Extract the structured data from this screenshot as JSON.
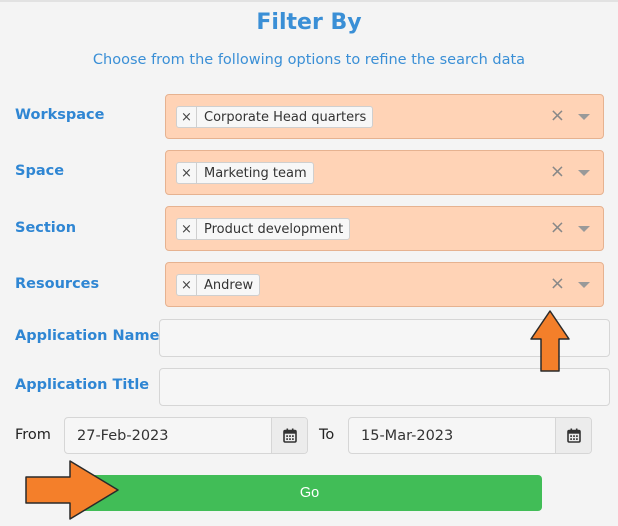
{
  "header": {
    "title": "Filter By",
    "subtitle": "Choose from the following options to refine the search data"
  },
  "filters": {
    "workspace": {
      "label": "Workspace",
      "selected": "Corporate Head quarters",
      "remove_glyph": "×",
      "clear_glyph": "×"
    },
    "space": {
      "label": "Space",
      "selected": "Marketing team",
      "remove_glyph": "×",
      "clear_glyph": "×"
    },
    "section": {
      "label": "Section",
      "selected": "Product development",
      "remove_glyph": "×",
      "clear_glyph": "×"
    },
    "resources": {
      "label": "Resources",
      "selected": "Andrew",
      "remove_glyph": "×",
      "clear_glyph": "×"
    }
  },
  "fields": {
    "application_name": {
      "label": "Application Name",
      "value": ""
    },
    "application_title": {
      "label": "Application Title",
      "value": ""
    }
  },
  "dates": {
    "from_label": "From",
    "from_value": "27-Feb-2023",
    "to_label": "To",
    "to_value": "15-Mar-2023"
  },
  "actions": {
    "go_label": "Go"
  },
  "colors": {
    "accent": "#3a8fd6",
    "select_bg": "#ffd3b6",
    "go_button": "#41bd57",
    "annotation_arrow": "#f47f2a"
  }
}
